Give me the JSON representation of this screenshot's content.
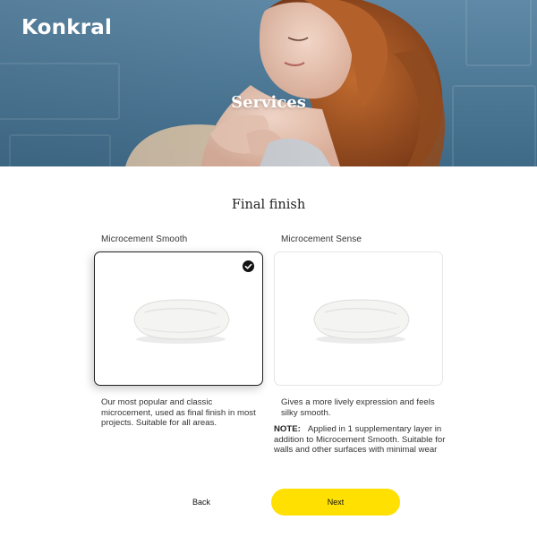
{
  "header": {
    "logo_text": "Konkral",
    "hero_title": "Services"
  },
  "finish": {
    "title": "Final finish",
    "options": [
      {
        "label": "Microcement Smooth",
        "description": "Our most popular and classic microcement, used as final finish in most projects. Suitable for all areas.",
        "selected": true,
        "icon": "pillow-icon"
      },
      {
        "label": "Microcement Sense",
        "description": "Gives a more lively expression and feels silky smooth.",
        "selected": false,
        "icon": "pillow-icon"
      }
    ],
    "note_label": "NOTE:",
    "note_text": "Applied in 1 supplementary layer in addition to Microcement Smooth. Suitable for walls and other surfaces with minimal wear"
  },
  "nav": {
    "back_label": "Back",
    "next_label": "Next"
  },
  "colors": {
    "accent": "#ffe000",
    "selected_border": "#1f1f1f",
    "hero_blue": "#4d7895"
  }
}
